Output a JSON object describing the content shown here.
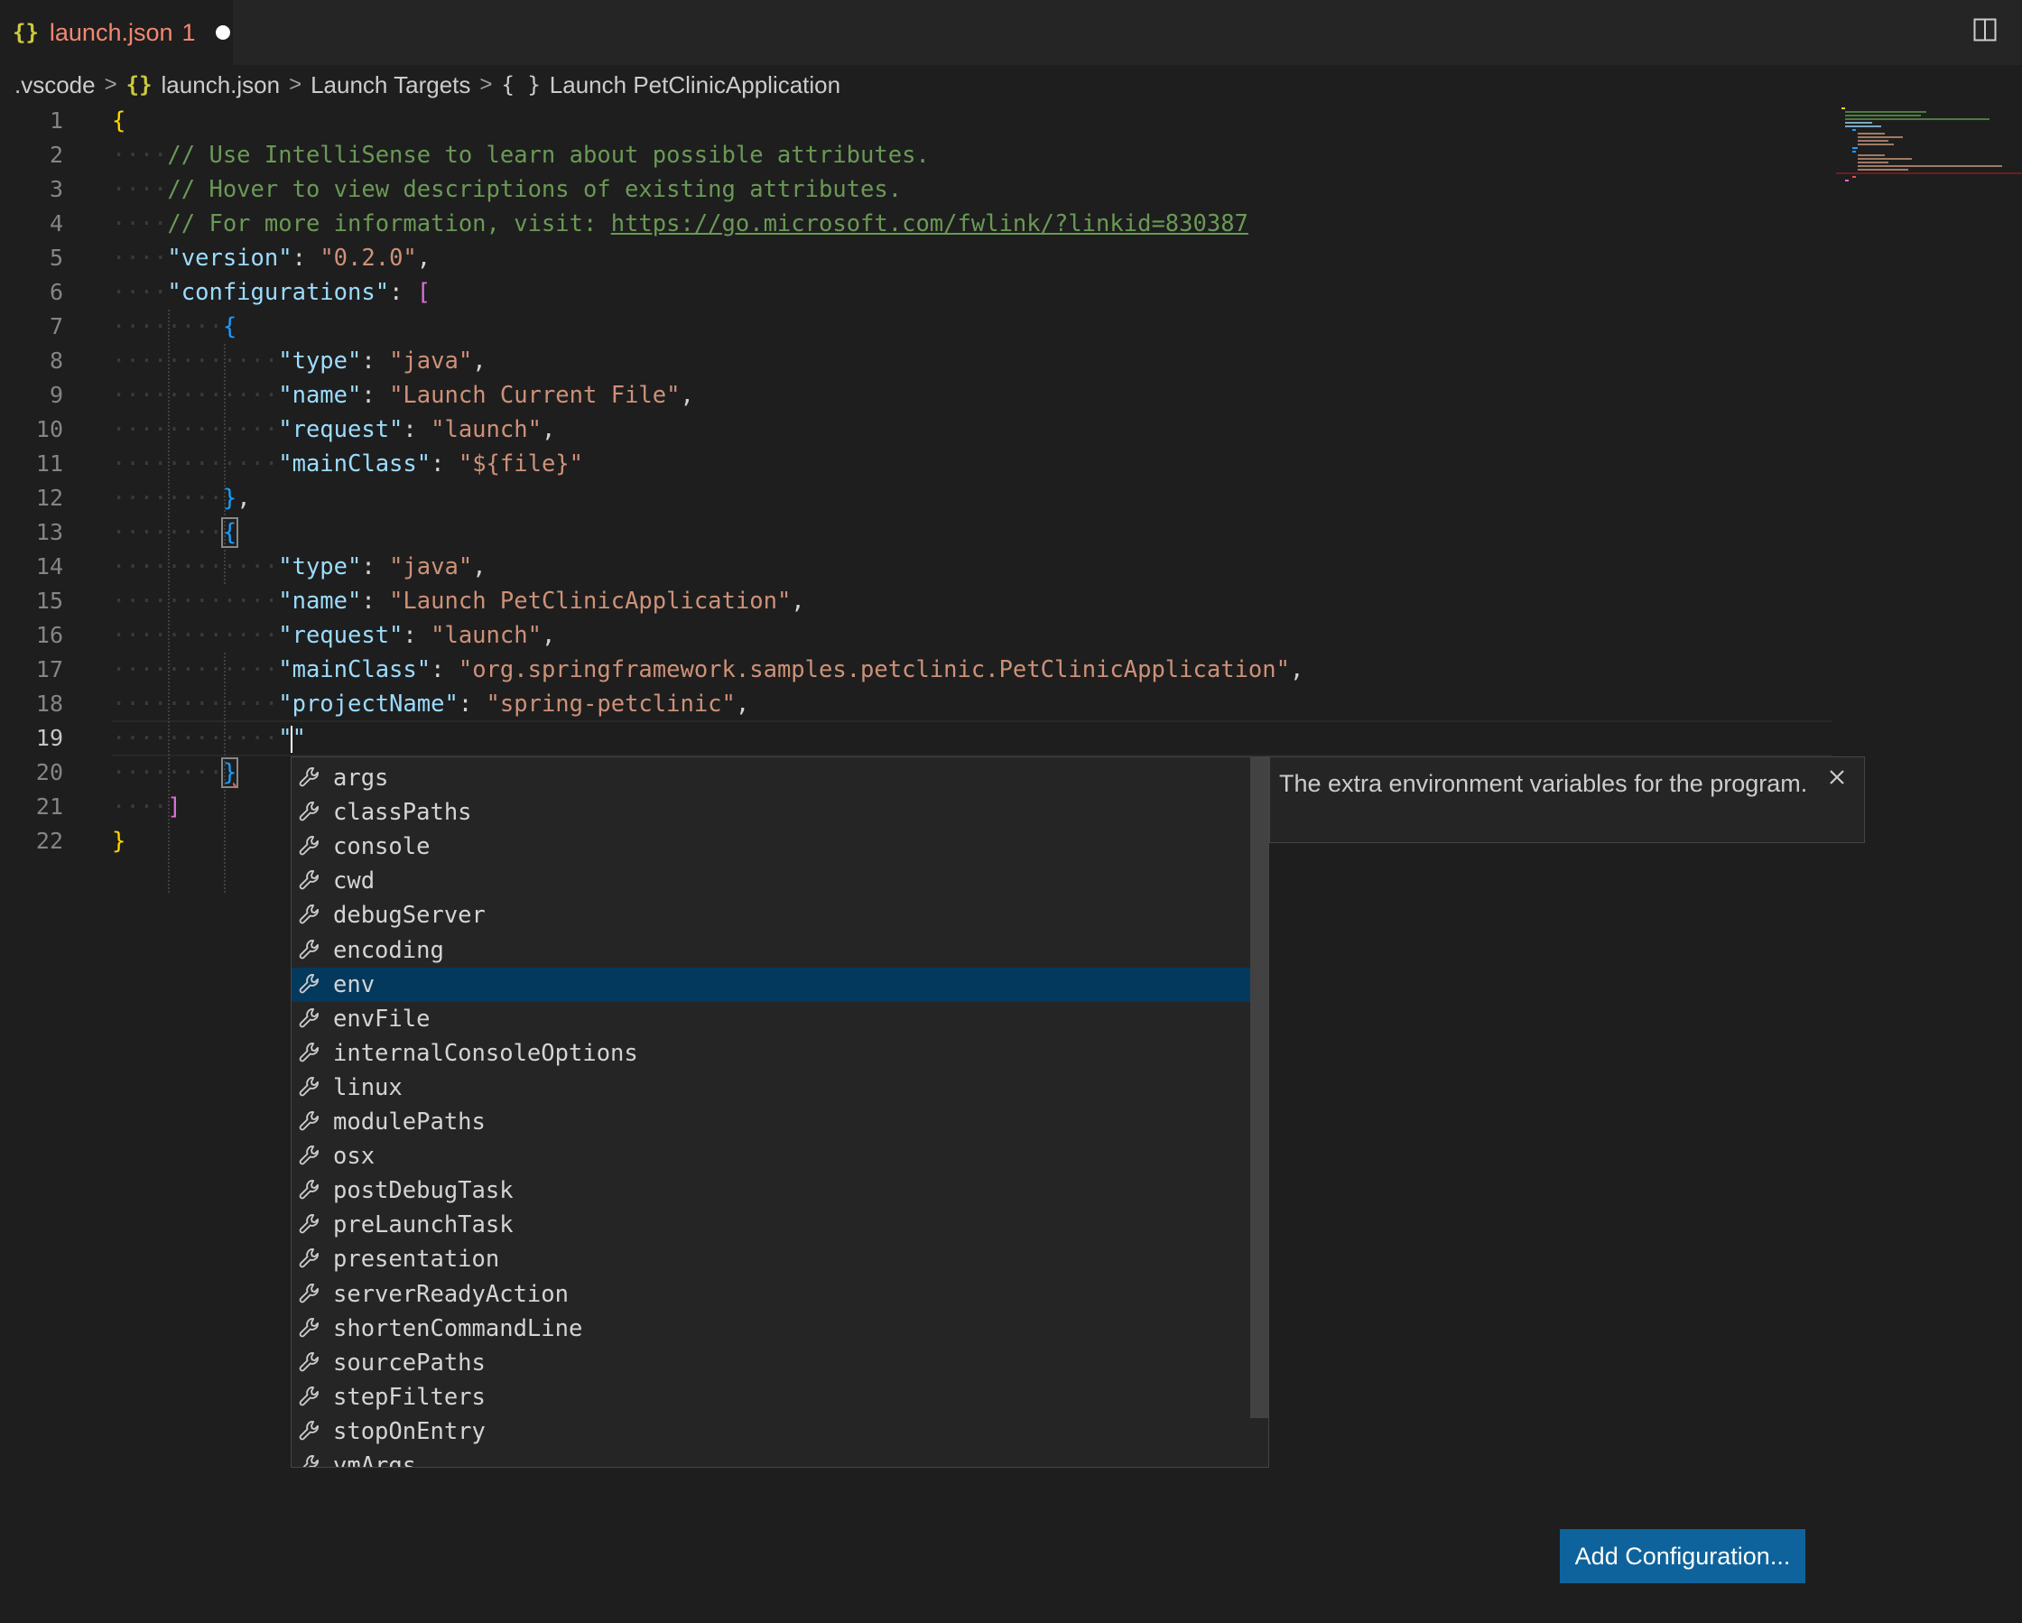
{
  "tab": {
    "icon": "{}",
    "name": "launch.json",
    "problems": "1"
  },
  "breadcrumb": {
    "folder": ".vscode",
    "file_icon": "{}",
    "file": "launch.json",
    "section": "Launch Targets",
    "obj_icon": "{ }",
    "target": "Launch PetClinicApplication"
  },
  "editor": {
    "line_numbers": [
      "1",
      "2",
      "3",
      "4",
      "5",
      "6",
      "7",
      "8",
      "9",
      "10",
      "11",
      "12",
      "13",
      "14",
      "15",
      "16",
      "17",
      "18",
      "19",
      "20",
      "21",
      "22"
    ],
    "code": {
      "brace_open": "{",
      "comment1": "// Use IntelliSense to learn about possible attributes.",
      "comment2": "// Hover to view descriptions of existing attributes.",
      "comment3_prefix": "// For more information, visit: ",
      "comment3_link": "https://go.microsoft.com/fwlink/?linkid=830387",
      "version_key": "\"version\"",
      "version_val": "\"0.2.0\"",
      "configs_key": "\"configurations\"",
      "array_open": "[",
      "obj_open": "{",
      "cfg1": {
        "type_key": "\"type\"",
        "type_val": "\"java\"",
        "name_key": "\"name\"",
        "name_val": "\"Launch Current File\"",
        "request_key": "\"request\"",
        "request_val": "\"launch\"",
        "main_key": "\"mainClass\"",
        "main_val": "\"${file}\""
      },
      "obj_close": "}",
      "cfg2": {
        "type_key": "\"type\"",
        "type_val": "\"java\"",
        "name_key": "\"name\"",
        "name_val": "\"Launch PetClinicApplication\"",
        "request_key": "\"request\"",
        "request_val": "\"launch\"",
        "main_key": "\"mainClass\"",
        "main_val": "\"org.springframework.samples.petclinic.PetClinicApplication\"",
        "project_key": "\"projectName\"",
        "project_val": "\"spring-petclinic\"",
        "typing": "\"\""
      },
      "array_close": "]",
      "brace_close": "}"
    }
  },
  "suggest": {
    "items": [
      "args",
      "classPaths",
      "console",
      "cwd",
      "debugServer",
      "encoding",
      "env",
      "envFile",
      "internalConsoleOptions",
      "linux",
      "modulePaths",
      "osx",
      "postDebugTask",
      "preLaunchTask",
      "presentation",
      "serverReadyAction",
      "shortenCommandLine",
      "sourcePaths",
      "stepFilters",
      "stopOnEntry",
      "vmArgs"
    ],
    "selected": "env",
    "item_icon": "wrench-icon"
  },
  "details": {
    "text": "The extra environment variables for the program."
  },
  "add_configuration": {
    "label": "Add Configuration..."
  },
  "colors": {
    "background": "#1e1e1e",
    "selected_item": "#04395e",
    "button": "#0e639c",
    "comment": "#6a9955",
    "key": "#9cdcfe",
    "string": "#ce9178"
  }
}
